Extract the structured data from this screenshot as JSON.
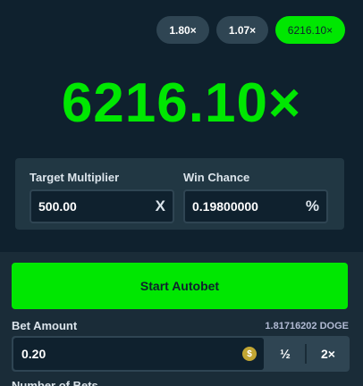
{
  "history": [
    {
      "label": "1.80×",
      "active": false
    },
    {
      "label": "1.07×",
      "active": false
    },
    {
      "label": "6216.10×",
      "active": true
    }
  ],
  "result": {
    "multiplier": "6216.10×"
  },
  "calculator": {
    "target_label": "Target Multiplier",
    "target_value": "500.00",
    "target_suffix": "X",
    "chance_label": "Win Chance",
    "chance_value": "0.19800000",
    "chance_suffix": "%"
  },
  "autobet": {
    "button_label": "Start Autobet"
  },
  "bet": {
    "label": "Bet Amount",
    "balance": "1.81716202 DOGE",
    "value": "0.20",
    "currency_icon": "doge-coin-icon",
    "half_label": "½",
    "double_label": "2×"
  },
  "next_section": {
    "label": "Number of Bets"
  },
  "colors": {
    "accent": "#00e701",
    "background": "#0f212e",
    "panel": "#213743",
    "control": "#2f4553"
  }
}
